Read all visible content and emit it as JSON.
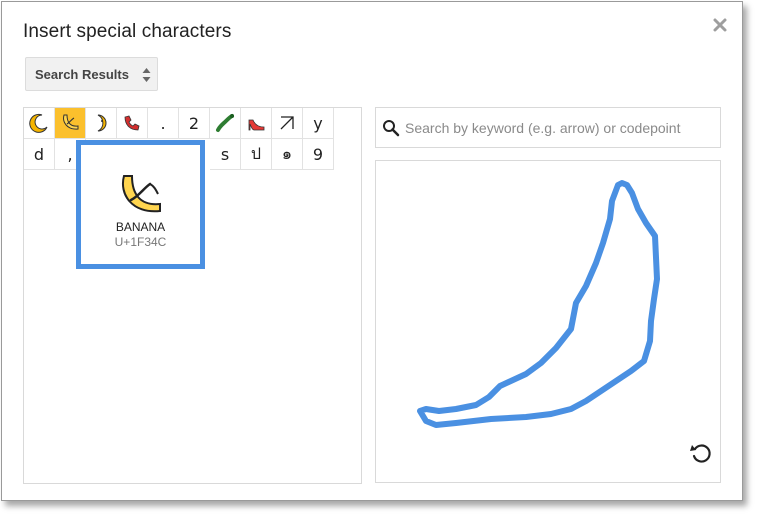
{
  "dialog": {
    "title": "Insert special characters",
    "close_icon": "close-x-icon"
  },
  "category_select": {
    "label": "Search Results",
    "icon": "updown-arrows-icon"
  },
  "grid": {
    "row1": [
      {
        "name": "crescent-moon",
        "glyph": "🌙",
        "icon": true
      },
      {
        "name": "banana",
        "glyph": "🍌",
        "icon": true,
        "selected": true
      },
      {
        "name": "last-quarter-moon-face",
        "glyph": "🌜",
        "icon": true
      },
      {
        "name": "telephone-receiver",
        "glyph": "📞",
        "icon": true
      },
      {
        "name": "period",
        "glyph": "."
      },
      {
        "name": "digit-two",
        "glyph": "2"
      },
      {
        "name": "caterpillar",
        "glyph": "🐛",
        "icon": true
      },
      {
        "name": "high-heel",
        "glyph": "👠",
        "icon": true
      },
      {
        "name": "arrow-up-right",
        "glyph": "↗"
      },
      {
        "name": "letter-y",
        "glyph": "y"
      }
    ],
    "row2": [
      {
        "name": "letter-d",
        "glyph": "d"
      },
      {
        "name": "comma",
        "glyph": ","
      },
      {
        "name": "hidden-1",
        "glyph": ""
      },
      {
        "name": "hidden-2",
        "glyph": ""
      },
      {
        "name": "hidden-3",
        "glyph": ""
      },
      {
        "name": "hidden-4",
        "glyph": ""
      },
      {
        "name": "letter-s",
        "glyph": "s"
      },
      {
        "name": "thai-bo-bai-mai",
        "glyph": "ป"
      },
      {
        "name": "thai-digit-nine",
        "glyph": "๑"
      },
      {
        "name": "digit-nine",
        "glyph": "9"
      }
    ]
  },
  "preview": {
    "name": "BANANA",
    "codepoint": "U+1F34C",
    "icon": "banana-icon"
  },
  "search": {
    "placeholder": "Search by keyword (e.g. arrow) or codepoint",
    "value": "",
    "icon": "magnifier-icon"
  },
  "drawing_area": {
    "stroke_color": "#4a90e2",
    "undo_icon": "undo-icon"
  },
  "colors": {
    "selected_cell": "#fbc02d",
    "highlight_border": "#4a90e2"
  }
}
